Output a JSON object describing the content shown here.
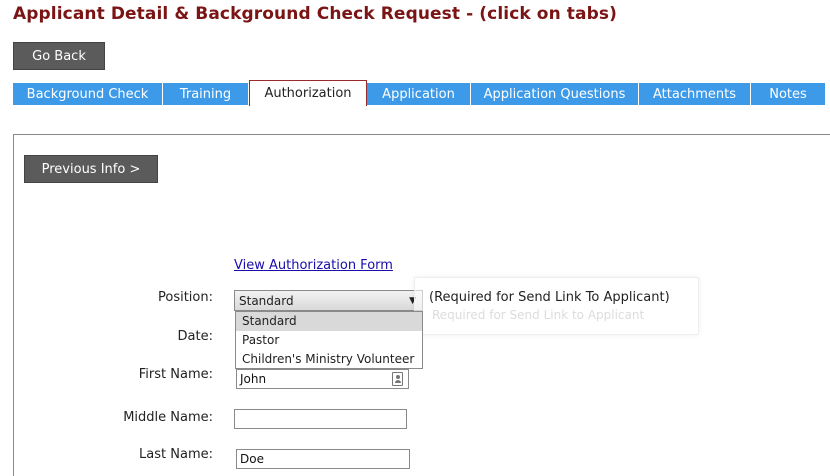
{
  "page": {
    "title": "Applicant Detail & Background Check Request - (click on tabs)"
  },
  "buttons": {
    "go_back": "Go Back",
    "previous_info": "Previous Info >"
  },
  "tabs": [
    {
      "label": "Background Check"
    },
    {
      "label": "Training"
    },
    {
      "label": "Authorization",
      "active": true
    },
    {
      "label": "Application"
    },
    {
      "label": "Application Questions"
    },
    {
      "label": "Attachments"
    },
    {
      "label": "Notes"
    }
  ],
  "form": {
    "view_link": "View Authorization Form",
    "position": {
      "label": "Position:",
      "selected": "Standard",
      "note": "(Required for Send Link To Applicant)",
      "tooltip": "Required for Send Link to Applicant",
      "options": [
        "Standard",
        "Pastor",
        "Children's Ministry Volunteer"
      ]
    },
    "date": {
      "label": "Date:"
    },
    "first_name": {
      "label": "First Name:",
      "value": "John"
    },
    "middle_name": {
      "label": "Middle Name:",
      "value": ""
    },
    "last_name": {
      "label": "Last Name:",
      "value": "Doe"
    }
  },
  "colors": {
    "title": "#7b1414",
    "tab": "#3d9ae8",
    "button": "#5b5b5b",
    "link": "#1a0dab"
  }
}
